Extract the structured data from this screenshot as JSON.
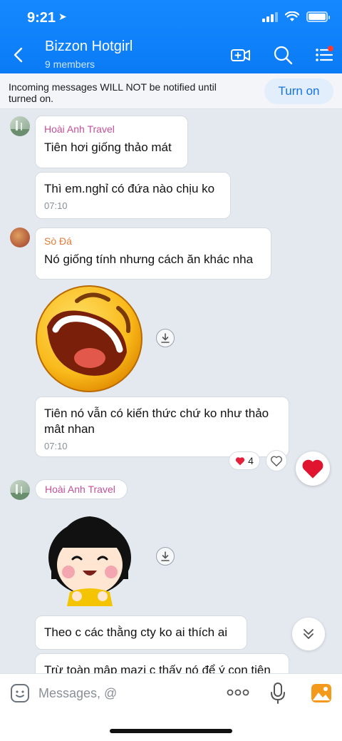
{
  "status_bar": {
    "time": "9:21"
  },
  "header": {
    "title": "Bizzon Hotgirl",
    "subtitle": "9 members"
  },
  "notification": {
    "text": "Incoming messages WILL NOT be notified until turned on.",
    "button": "Turn on"
  },
  "messages": [
    {
      "sender": "Hoài Anh Travel",
      "text": "Tiên hơi giống thảo mát"
    },
    {
      "text": "Thì em.nghỉ có đứa nào chịu ko",
      "time": "07:10"
    },
    {
      "sender": "Sò Đá",
      "text": "Nó giống tính nhưng cách ăn khác nha"
    },
    {
      "text": "Tiên nó vẫn có kiến thức chứ ko như thảo mât nhan",
      "time": "07:10",
      "reaction_count": "4"
    },
    {
      "sender": "Hoài Anh Travel"
    },
    {
      "text": "Theo c các thằng cty ko ai thích ai"
    },
    {
      "text": "Trừ toàn mập mạzi c thấy nó để ý con tiên"
    }
  ],
  "composer": {
    "placeholder": "Messages, @"
  },
  "colors": {
    "accent": "#0a7bf5",
    "sender_pink": "#c4509a",
    "sender_orange": "#e07b39"
  }
}
